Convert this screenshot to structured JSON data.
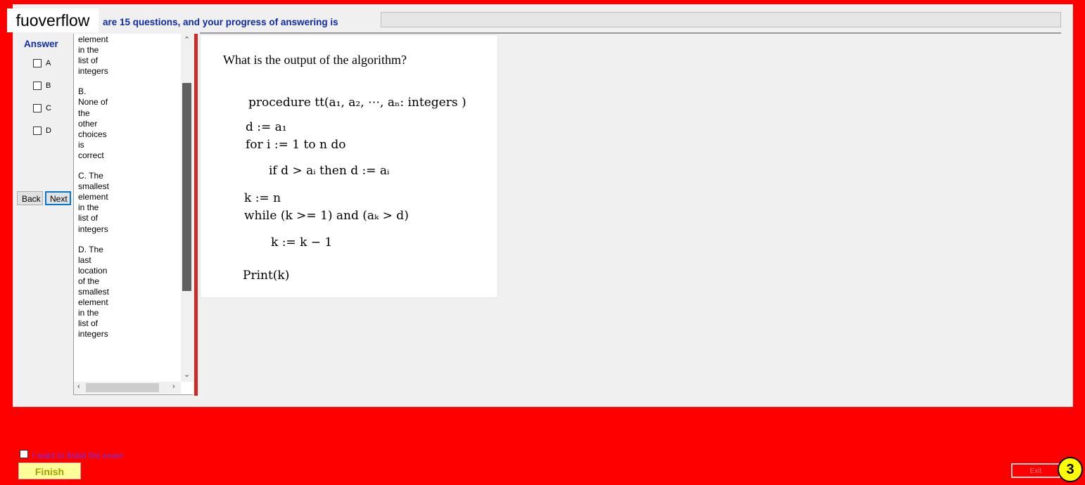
{
  "brand": {
    "name": "fuoverflow"
  },
  "progress": {
    "text": "are 15 questions, and your progress of answering is",
    "fraction": 0.0
  },
  "answer": {
    "label": "Answer",
    "options": [
      {
        "label": "A",
        "checked": false
      },
      {
        "label": "B",
        "checked": false
      },
      {
        "label": "C",
        "checked": false
      },
      {
        "label": "D",
        "checked": false
      }
    ]
  },
  "nav": {
    "back_label": "Back",
    "next_label": "Next"
  },
  "choices": [
    "element\nin the\nlist of\nintegers",
    "B.\nNone of\nthe\nother\nchoices\nis\ncorrect",
    "C.  The\nsmallest\nelement\nin the\nlist of\nintegers",
    "D.  The\nlast\nlocation\nof the\nsmallest\nelement\nin the\nlist of\nintegers"
  ],
  "question": {
    "title": "What is the output of the algorithm?",
    "lines": [
      "procedure tt(a₁, a₂, ⋯, aₙ: integers )",
      "d := a₁",
      "for i := 1 to n do",
      "if d > aᵢ then d := aᵢ",
      "k := n",
      "while (k >= 1) and (aₖ > d)",
      "k := k − 1",
      "Print(k)"
    ]
  },
  "footer": {
    "finish_checkbox_label": "I want to finish the exam",
    "finish_label": "Finish",
    "exit_label": "Exit",
    "badge": "3"
  },
  "colors": {
    "background": "#ff0000",
    "heading_blue": "#0d2aa8",
    "finish_bg": "#ffff99",
    "badge_bg": "#ffff00"
  },
  "icons": {
    "scroll_up": "chevron-up-icon",
    "scroll_down": "chevron-down-icon",
    "scroll_left": "chevron-left-icon",
    "scroll_right": "chevron-right-icon"
  }
}
